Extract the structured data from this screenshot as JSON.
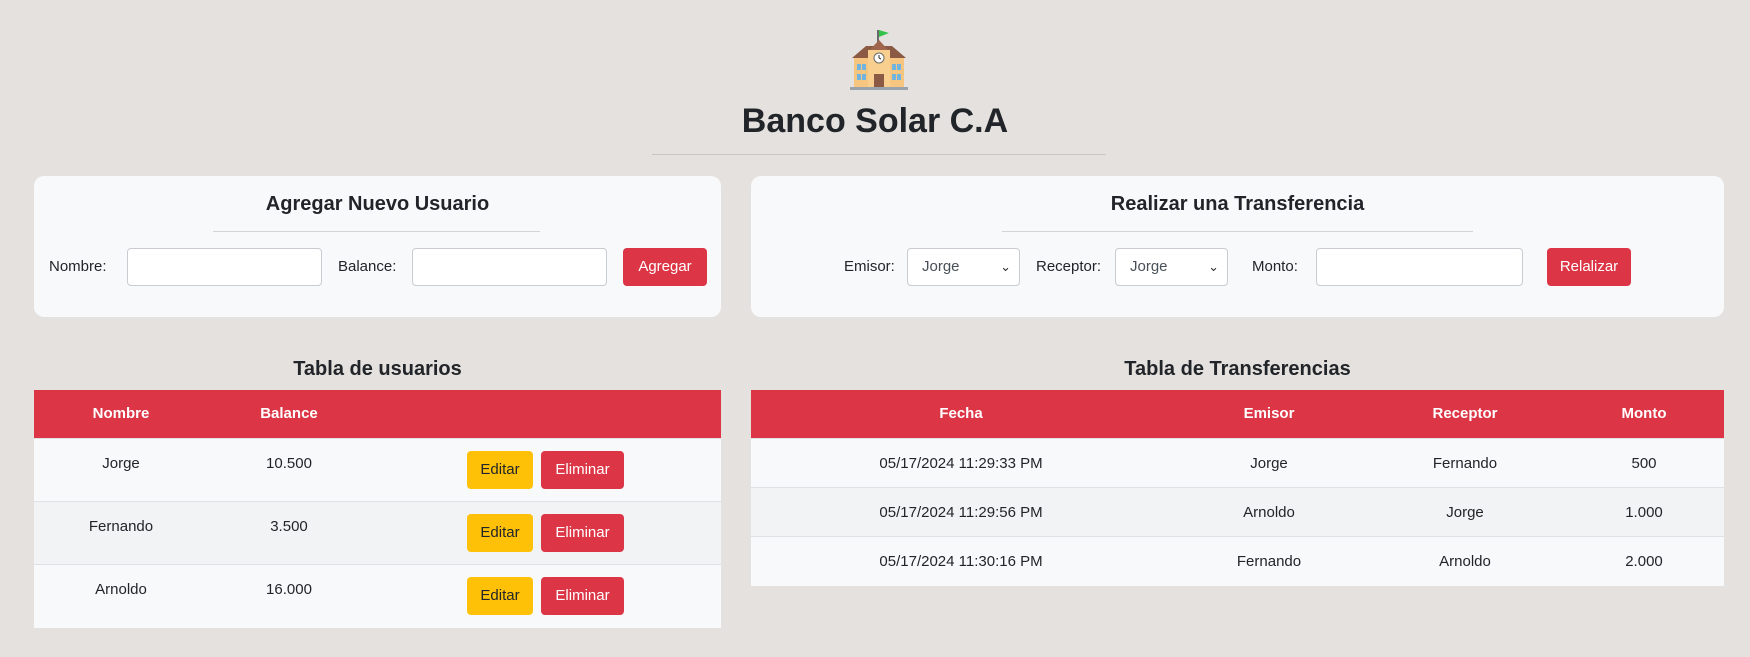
{
  "header": {
    "logo_icon": "school-building-icon",
    "title": "Banco Solar C.A"
  },
  "add_user": {
    "title": "Agregar Nuevo Usuario",
    "name_label": "Nombre:",
    "name_value": "",
    "balance_label": "Balance:",
    "balance_value": "",
    "add_button": "Agregar"
  },
  "transfer": {
    "title": "Realizar una Transferencia",
    "sender_label": "Emisor:",
    "sender_selected": "Jorge",
    "receiver_label": "Receptor:",
    "receiver_selected": "Jorge",
    "amount_label": "Monto:",
    "amount_value": "",
    "submit_button": "Relalizar"
  },
  "users_table": {
    "title": "Tabla de usuarios",
    "headers": [
      "Nombre",
      "Balance"
    ],
    "edit_label": "Editar",
    "delete_label": "Eliminar",
    "rows": [
      {
        "name": "Jorge",
        "balance": "10.500"
      },
      {
        "name": "Fernando",
        "balance": "3.500"
      },
      {
        "name": "Arnoldo",
        "balance": "16.000"
      }
    ]
  },
  "transfers_table": {
    "title": "Tabla de Transferencias",
    "headers": [
      "Fecha",
      "Emisor",
      "Receptor",
      "Monto"
    ],
    "rows": [
      {
        "date": "05/17/2024 11:29:33 PM",
        "sender": "Jorge",
        "receiver": "Fernando",
        "amount": "500"
      },
      {
        "date": "05/17/2024 11:29:56 PM",
        "sender": "Arnoldo",
        "receiver": "Jorge",
        "amount": "1.000"
      },
      {
        "date": "05/17/2024 11:30:16 PM",
        "sender": "Fernando",
        "receiver": "Arnoldo",
        "amount": "2.000"
      }
    ]
  },
  "colors": {
    "background": "#e5e1de",
    "accent_red": "#dc3545",
    "accent_yellow": "#ffc107"
  }
}
